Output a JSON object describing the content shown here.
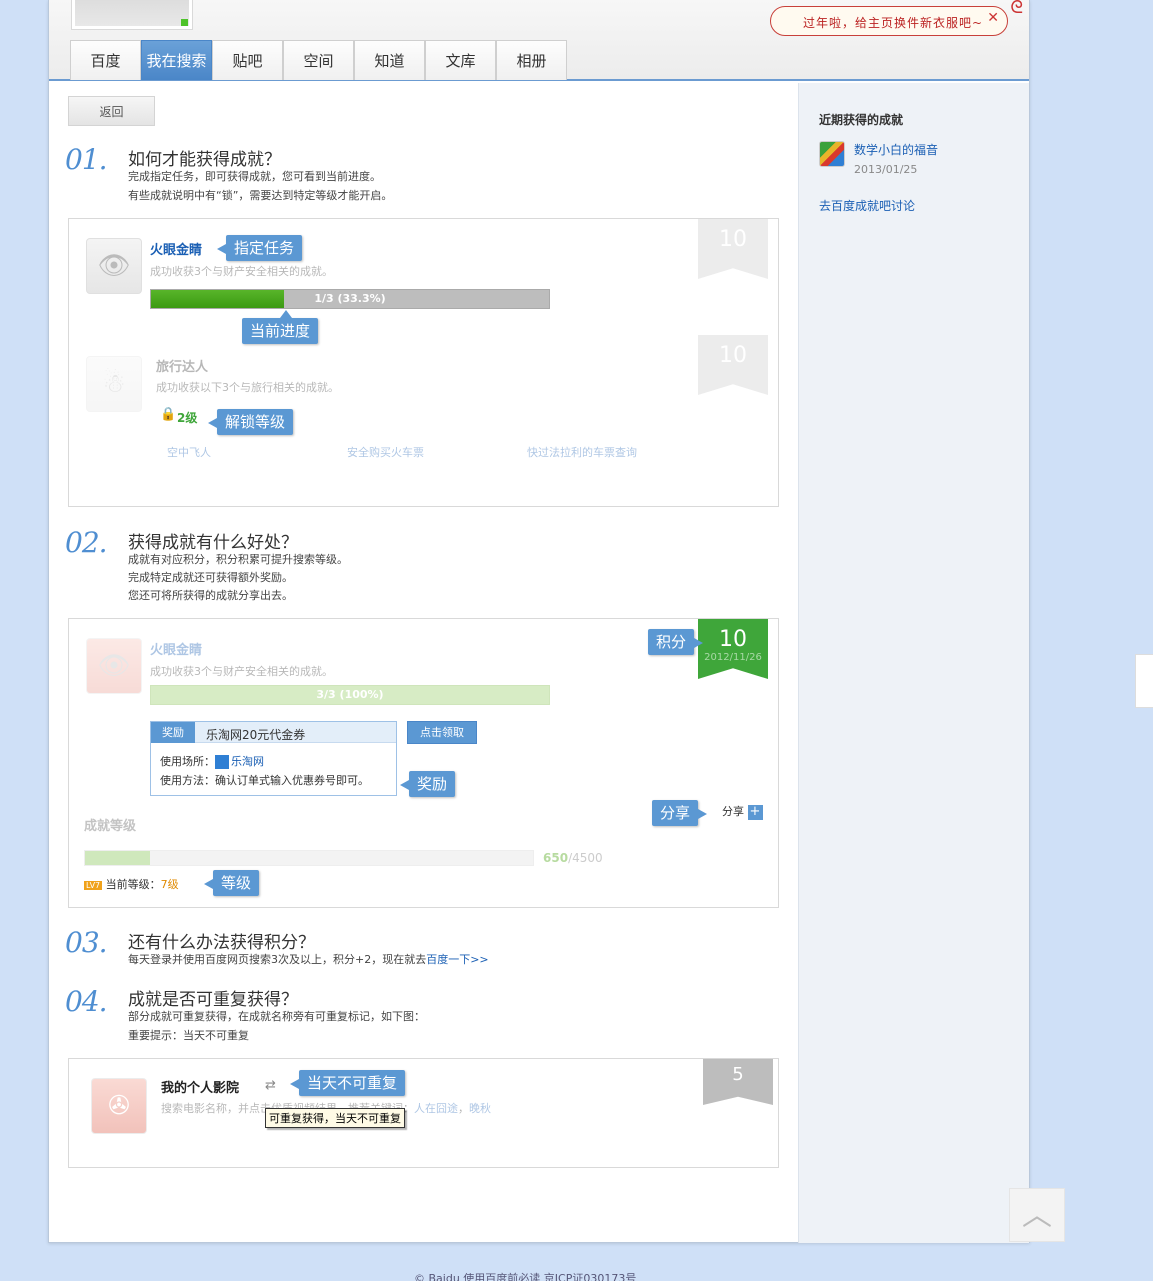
{
  "header": {
    "banner_text": "过年啦，给主页换件新衣服吧~",
    "tabs": [
      "百度",
      "我在搜索",
      "贴吧",
      "空间",
      "知道",
      "文库",
      "相册"
    ]
  },
  "sidebar": {
    "title": "近期获得的成就",
    "achievement_name": "数学小白的福音",
    "achievement_date": "2013/01/25",
    "discuss_link": "去百度成就吧讨论"
  },
  "main": {
    "back_button": "返回",
    "s1": {
      "num": "01.",
      "title": "如何才能获得成就？",
      "lines": [
        "完成指定任务，即可获得成就，您可看到当前进度。",
        "有些成就说明中有“锁”，需要达到特定等级才能开启。"
      ],
      "ach1": {
        "name": "火眼金睛",
        "desc": "成功收获3个与财产安全相关的成就。",
        "progress_text": "1/3 (33.3%)",
        "progress_fraction": 0.333,
        "points": "10"
      },
      "ach2": {
        "name": "旅行达人",
        "desc": "成功收获以下3个与旅行相关的成就。",
        "level": "2级",
        "points": "10",
        "subs": [
          "空中飞人",
          "安全购买火车票",
          "快过法拉利的车票查询"
        ]
      },
      "callouts": {
        "task": "指定任务",
        "progress": "当前进度",
        "unlock": "解锁等级"
      }
    },
    "s2": {
      "num": "02.",
      "title": "获得成就有什么好处？",
      "lines": [
        "成就有对应积分，积分积累可提升搜索等级。",
        "完成特定成就还可获得额外奖励。",
        "您还可将所获得的成就分享出去。"
      ],
      "ach": {
        "name": "火眼金睛",
        "desc": "成功收获3个与财产安全相关的成就。",
        "progress_text": "3/3 (100%)",
        "progress_fraction": 1.0,
        "points": "10",
        "date": "2012/11/26"
      },
      "reward": {
        "tag": "奖励",
        "name": "乐淘网20元代金券",
        "place_label": "使用场所：",
        "place": "乐淘网",
        "usage": "使用方法：确认订单式输入优惠券号即可。",
        "claim": "点击领取"
      },
      "share_label": "分享",
      "level_title": "成就等级",
      "level_score": "650",
      "level_total": "/4500",
      "level_fraction": 0.144,
      "current_level_label": "当前等级：",
      "current_level": "7级",
      "level_badge": "LV7",
      "callouts": {
        "points": "积分",
        "reward": "奖励",
        "share": "分享",
        "level": "等级"
      }
    },
    "s3": {
      "num": "03.",
      "title": "还有什么办法获得积分？",
      "line": "每天登录并使用百度网页搜索3次及以上，积分+2，现在就去",
      "link": "百度一下>>"
    },
    "s4": {
      "num": "04.",
      "title": "成就是否可重复获得？",
      "lines": [
        "部分成就可重复获得，在成就名称旁有可重复标记，如下图：",
        "重要提示：当天不可重复"
      ],
      "ach": {
        "name": "我的个人影院",
        "desc": "搜索电影名称，并点击优质视频结果，推荐关键词：",
        "kw1": "人在囧途",
        "kw2": "晚秋",
        "points": "5"
      },
      "tooltip": "可重复获得，当天不可重复",
      "callout": "当天不可重复"
    }
  },
  "footer": "© Baidu 使用百度前必读 京ICP证030173号"
}
